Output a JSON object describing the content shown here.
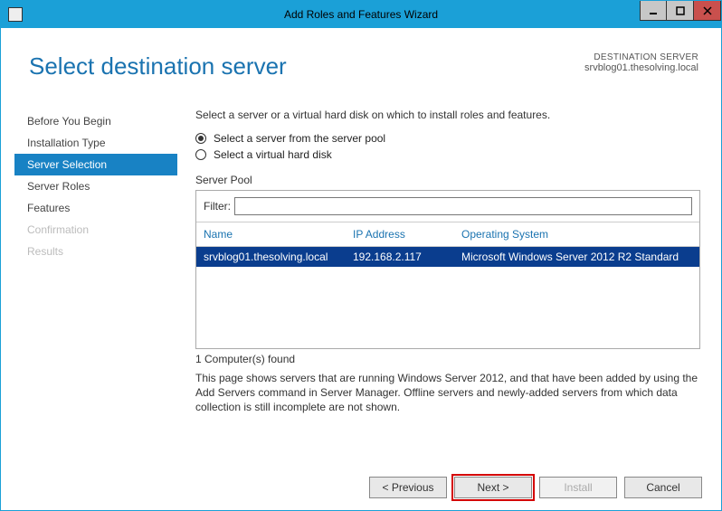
{
  "titlebar": {
    "title": "Add Roles and Features Wizard"
  },
  "page_title": "Select destination server",
  "destination": {
    "label": "DESTINATION SERVER",
    "value": "srvblog01.thesolving.local"
  },
  "sidebar": {
    "items": [
      {
        "label": "Before You Begin",
        "state": "normal"
      },
      {
        "label": "Installation Type",
        "state": "normal"
      },
      {
        "label": "Server Selection",
        "state": "active"
      },
      {
        "label": "Server Roles",
        "state": "normal"
      },
      {
        "label": "Features",
        "state": "normal"
      },
      {
        "label": "Confirmation",
        "state": "disabled"
      },
      {
        "label": "Results",
        "state": "disabled"
      }
    ]
  },
  "main": {
    "instruction": "Select a server or a virtual hard disk on which to install roles and features.",
    "radios": {
      "pool": "Select a server from the server pool",
      "vhd": "Select a virtual hard disk"
    },
    "server_pool_label": "Server Pool",
    "filter_label": "Filter:",
    "columns": {
      "name": "Name",
      "ip": "IP Address",
      "os": "Operating System"
    },
    "rows": [
      {
        "name": "srvblog01.thesolving.local",
        "ip": "192.168.2.117",
        "os": "Microsoft Windows Server 2012 R2 Standard"
      }
    ],
    "found": "1 Computer(s) found",
    "footnote": "This page shows servers that are running Windows Server 2012, and that have been added by using the Add Servers command in Server Manager. Offline servers and newly-added servers from which data collection is still incomplete are not shown."
  },
  "buttons": {
    "previous": "< Previous",
    "next": "Next >",
    "install": "Install",
    "cancel": "Cancel"
  }
}
